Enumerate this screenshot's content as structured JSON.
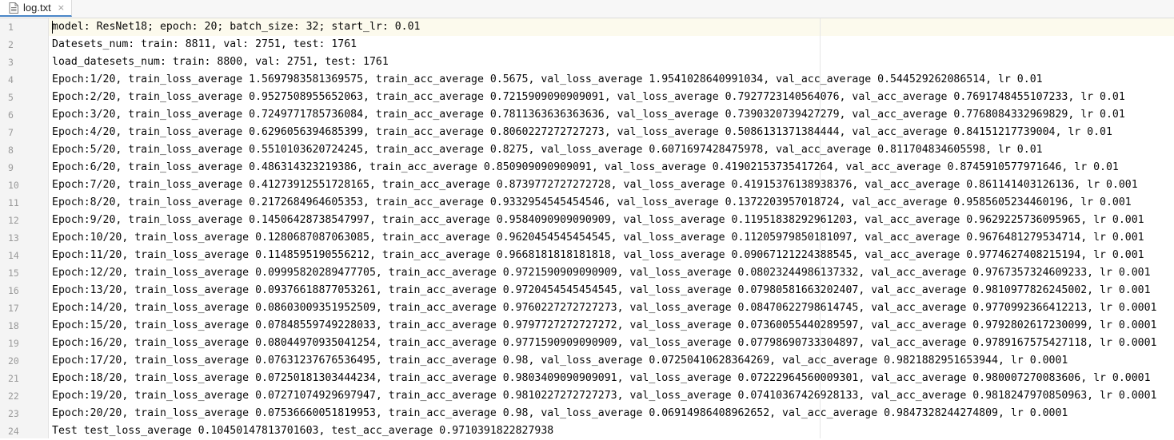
{
  "tab": {
    "filename": "log.txt",
    "close_glyph": "×",
    "icon": "text-file-icon"
  },
  "lines": [
    {
      "num": "1",
      "text": "model: ResNet18; epoch: 20; batch_size: 32; start_lr: 0.01"
    },
    {
      "num": "2",
      "text": "Datesets_num: train: 8811, val: 2751, test: 1761"
    },
    {
      "num": "3",
      "text": "load_datesets_num: train: 8800, val: 2751, test: 1761"
    },
    {
      "num": "4",
      "text": "Epoch:1/20, train_loss_average 1.5697983581369575, train_acc_average 0.5675, val_loss_average 1.9541028640991034, val_acc_average 0.544529262086514, lr 0.01"
    },
    {
      "num": "5",
      "text": "Epoch:2/20, train_loss_average 0.9527508955652063, train_acc_average 0.7215909090909091, val_loss_average 0.7927723140564076, val_acc_average 0.7691748455107233, lr 0.01"
    },
    {
      "num": "6",
      "text": "Epoch:3/20, train_loss_average 0.7249771785736084, train_acc_average 0.7811363636363636, val_loss_average 0.7390320739427279, val_acc_average 0.7768084332969829, lr 0.01"
    },
    {
      "num": "7",
      "text": "Epoch:4/20, train_loss_average 0.6296056394685399, train_acc_average 0.8060227272727273, val_loss_average 0.5086131371384444, val_acc_average 0.84151217739004, lr 0.01"
    },
    {
      "num": "8",
      "text": "Epoch:5/20, train_loss_average 0.5510103620724245, train_acc_average 0.8275, val_loss_average 0.6071697428475978, val_acc_average 0.811704834605598, lr 0.01"
    },
    {
      "num": "9",
      "text": "Epoch:6/20, train_loss_average 0.486314323219386, train_acc_average 0.850909090909091, val_loss_average 0.41902153735417264, val_acc_average 0.8745910577971646, lr 0.01"
    },
    {
      "num": "10",
      "text": "Epoch:7/20, train_loss_average 0.41273912551728165, train_acc_average 0.8739772727272728, val_loss_average 0.41915376138938376, val_acc_average 0.861141403126136, lr 0.001"
    },
    {
      "num": "11",
      "text": "Epoch:8/20, train_loss_average 0.2172684964605353, train_acc_average 0.9332954545454546, val_loss_average 0.1372203957018724, val_acc_average 0.9585605234460196, lr 0.001"
    },
    {
      "num": "12",
      "text": "Epoch:9/20, train_loss_average 0.14506428738547997, train_acc_average 0.9584090909090909, val_loss_average 0.11951838292961203, val_acc_average 0.9629225736095965, lr 0.001"
    },
    {
      "num": "13",
      "text": "Epoch:10/20, train_loss_average 0.1280687087063085, train_acc_average 0.9620454545454545, val_loss_average 0.11205979850181097, val_acc_average 0.9676481279534714, lr 0.001"
    },
    {
      "num": "14",
      "text": "Epoch:11/20, train_loss_average 0.1148595190556212, train_acc_average 0.9668181818181818, val_loss_average 0.09067121224388545, val_acc_average 0.9774627408215194, lr 0.001"
    },
    {
      "num": "15",
      "text": "Epoch:12/20, train_loss_average 0.09995820289477705, train_acc_average 0.9721590909090909, val_loss_average 0.08023244986137332, val_acc_average 0.9767357324609233, lr 0.001"
    },
    {
      "num": "16",
      "text": "Epoch:13/20, train_loss_average 0.09376618877053261, train_acc_average 0.9720454545454545, val_loss_average 0.07980581663202407, val_acc_average 0.9810977826245002, lr 0.001"
    },
    {
      "num": "17",
      "text": "Epoch:14/20, train_loss_average 0.08603009351952509, train_acc_average 0.9760227272727273, val_loss_average 0.08470622798614745, val_acc_average 0.9770992366412213, lr 0.0001"
    },
    {
      "num": "18",
      "text": "Epoch:15/20, train_loss_average 0.07848559749228033, train_acc_average 0.9797727272727272, val_loss_average 0.07360055440289597, val_acc_average 0.9792802617230099, lr 0.0001"
    },
    {
      "num": "19",
      "text": "Epoch:16/20, train_loss_average 0.08044970935041254, train_acc_average 0.9771590909090909, val_loss_average 0.07798690733304897, val_acc_average 0.9789167575427118, lr 0.0001"
    },
    {
      "num": "20",
      "text": "Epoch:17/20, train_loss_average 0.07631237676536495, train_acc_average 0.98, val_loss_average 0.07250410628364269, val_acc_average 0.9821882951653944, lr 0.0001"
    },
    {
      "num": "21",
      "text": "Epoch:18/20, train_loss_average 0.07250181303444234, train_acc_average 0.9803409090909091, val_loss_average 0.07222964560009301, val_acc_average 0.980007270083606, lr 0.0001"
    },
    {
      "num": "22",
      "text": "Epoch:19/20, train_loss_average 0.07271074929697947, train_acc_average 0.9810227272727273, val_loss_average 0.07410367426928133, val_acc_average 0.9818247970850963, lr 0.0001"
    },
    {
      "num": "23",
      "text": "Epoch:20/20, train_loss_average 0.07536660051819953, train_acc_average 0.98, val_loss_average 0.06914986408962652, val_acc_average 0.9847328244274809, lr 0.0001"
    },
    {
      "num": "24",
      "text": "Test test_loss_average 0.10450147813701603, test_acc_average 0.9710391822827938"
    }
  ]
}
